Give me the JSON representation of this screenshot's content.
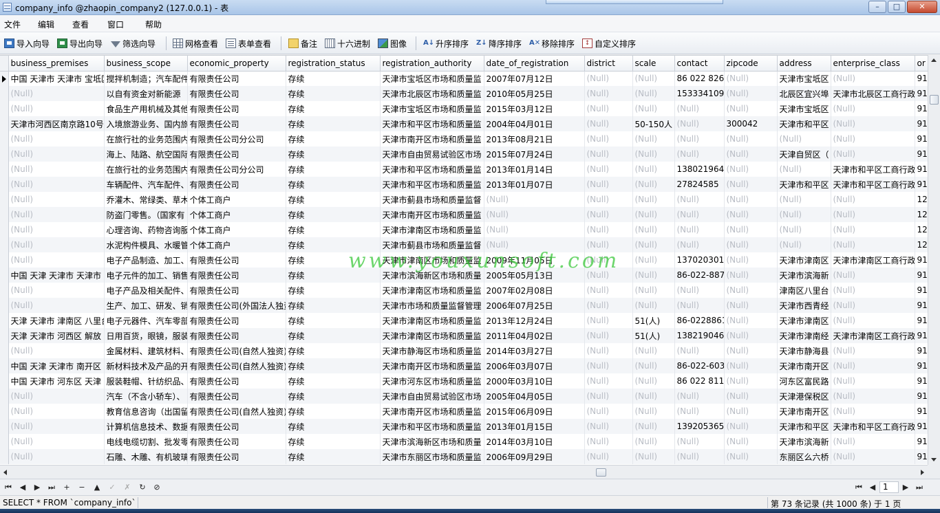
{
  "window": {
    "title": "company_info @zhaopin_company2 (127.0.0.1) - 表",
    "minimize": "–",
    "maximize": "□",
    "close": "✕"
  },
  "menu": [
    "文件",
    "编辑",
    "查看",
    "窗口",
    "帮助"
  ],
  "toolbar": {
    "import_wizard": "导入向导",
    "export_wizard": "导出向导",
    "filter_wizard": "筛选向导",
    "grid_view": "网格查看",
    "form_view": "表单查看",
    "memo": "备注",
    "hex": "十六进制",
    "image": "图像",
    "sort_asc": "升序排序",
    "sort_desc": "降序排序",
    "remove_sort": "移除排序",
    "custom_sort": "自定义排序"
  },
  "icons": {
    "import": "import-icon",
    "export": "export-icon",
    "filter": "filter-icon",
    "grid": "grid-icon",
    "form": "form-icon",
    "memo": "memo-icon",
    "hex": "hex-icon",
    "image": "image-icon",
    "sort_asc": "sort-asc-icon",
    "sort_desc": "sort-desc-icon",
    "remove_sort": "remove-sort-icon",
    "custom_sort": "custom-sort-icon"
  },
  "colors": {
    "null_text": "#b8bcc4",
    "watermark": "#3cc83c",
    "title_bar": "#b9d2ee"
  },
  "grid": {
    "columns": [
      "business_premises",
      "business_scope",
      "economic_property",
      "registration_status",
      "registration_authority",
      "date_of_registration",
      "district",
      "scale",
      "contact",
      "zipcode",
      "address",
      "enterprise_class",
      "or"
    ],
    "rows": [
      [
        "中国 天津市 天津市 宝坻区",
        "搅拌机制造；汽车配件",
        "有限责任公司",
        "存续",
        "天津市宝坻区市场和质量监",
        "2007年07月12日",
        "(Null)",
        "(Null)",
        "86 022 826",
        "(Null)",
        "天津市宝坻区",
        "(Null)",
        "91"
      ],
      [
        "(Null)",
        "以自有资金对新能源",
        "有限责任公司",
        "存续",
        "天津市北辰区市场和质量监",
        "2010年05月25日",
        "(Null)",
        "(Null)",
        "1533341099",
        "(Null)",
        "北辰区宜兴埠",
        "天津市北辰区工商行政",
        "91"
      ],
      [
        "(Null)",
        "食品生产用机械及其他",
        "有限责任公司",
        "存续",
        "天津市宝坻区市场和质量监",
        "2015年03月12日",
        "(Null)",
        "(Null)",
        "(Null)",
        "(Null)",
        "天津市宝坻区",
        "(Null)",
        "91"
      ],
      [
        "天津市河西区南京路10号",
        "入境旅游业务、国内旅",
        "有限责任公司",
        "存续",
        "天津市和平区市场和质量监",
        "2004年04月01日",
        "(Null)",
        "50-150人",
        "(Null)",
        "300042",
        "天津市和平区",
        "(Null)",
        "91"
      ],
      [
        "(Null)",
        "在旅行社的业务范围内",
        "有限责任公司分公司",
        "存续",
        "天津市南开区市场和质量监",
        "2013年08月21日",
        "(Null)",
        "(Null)",
        "(Null)",
        "(Null)",
        "(Null)",
        "(Null)",
        "91"
      ],
      [
        "(Null)",
        "海上、陆路、航空国际",
        "有限责任公司",
        "存续",
        "天津市自由贸易试验区市场",
        "2015年07月24日",
        "(Null)",
        "(Null)",
        "(Null)",
        "(Null)",
        "天津自贸区（",
        "(Null)",
        "91"
      ],
      [
        "(Null)",
        "在旅行社的业务范围内",
        "有限责任公司分公司",
        "存续",
        "天津市和平区市场和质量监",
        "2013年01月14日",
        "(Null)",
        "(Null)",
        "1380219645",
        "(Null)",
        "(Null)",
        "天津市和平区工商行政",
        "91"
      ],
      [
        "(Null)",
        "车辆配件、汽车配件、",
        "有限责任公司",
        "存续",
        "天津市和平区市场和质量监",
        "2013年01月07日",
        "(Null)",
        "(Null)",
        "27824585",
        "(Null)",
        "天津市和平区",
        "天津市和平区工商行政",
        "91"
      ],
      [
        "(Null)",
        "乔灌木、常绿类、草木",
        "个体工商户",
        "存续",
        "天津市蓟县市场和质量监督",
        "(Null)",
        "(Null)",
        "(Null)",
        "(Null)",
        "(Null)",
        "(Null)",
        "(Null)",
        "12"
      ],
      [
        "(Null)",
        "防盗门零售。（国家有",
        "个体工商户",
        "存续",
        "天津市南开区市场和质量监",
        "(Null)",
        "(Null)",
        "(Null)",
        "(Null)",
        "(Null)",
        "(Null)",
        "(Null)",
        "12"
      ],
      [
        "(Null)",
        "心理咨询、药物咨询服",
        "个体工商户",
        "存续",
        "天津市津南区市场和质量监",
        "(Null)",
        "(Null)",
        "(Null)",
        "(Null)",
        "(Null)",
        "(Null)",
        "(Null)",
        "12"
      ],
      [
        "(Null)",
        "水泥构件模具、水暖管",
        "个体工商户",
        "存续",
        "天津市蓟县市场和质量监督",
        "(Null)",
        "(Null)",
        "(Null)",
        "(Null)",
        "(Null)",
        "(Null)",
        "(Null)",
        "12"
      ],
      [
        "(Null)",
        "电子产品制造、加工、",
        "有限责任公司",
        "存续",
        "天津市津南区市场和质量监",
        "2009年11月05日",
        "(Null)",
        "(Null)",
        "1370203013",
        "(Null)",
        "天津市津南区",
        "天津市津南区工商行政",
        "91"
      ],
      [
        "中国 天津 天津市 天津市",
        "电子元件的加工、销售",
        "有限责任公司",
        "存续",
        "天津市滨海新区市场和质量",
        "2005年05月13日",
        "(Null)",
        "(Null)",
        "86-022-887",
        "(Null)",
        "天津市滨海新",
        "(Null)",
        "91"
      ],
      [
        "(Null)",
        "电子产品及相关配件、",
        "有限责任公司",
        "存续",
        "天津市津南区市场和质量监",
        "2007年02月08日",
        "(Null)",
        "(Null)",
        "(Null)",
        "(Null)",
        "津南区八里台",
        "(Null)",
        "91"
      ],
      [
        "(Null)",
        "生产、加工、研发、销",
        "有限责任公司(外国法人独资)",
        "存续",
        "天津市市场和质量监督管理",
        "2006年07月25日",
        "(Null)",
        "(Null)",
        "(Null)",
        "(Null)",
        "天津市西青经",
        "(Null)",
        "91"
      ],
      [
        "天津 天津市 津南区 八里台",
        "电子元器件、汽车零部",
        "有限责任公司",
        "存续",
        "天津市津南区市场和质量监",
        "2013年12月24日",
        "(Null)",
        "51(人)",
        "86-0228861",
        "(Null)",
        "天津市津南区",
        "(Null)",
        "91"
      ],
      [
        "天津 天津市 河西区 解放",
        "日用百货，眼镜，服装",
        "有限责任公司",
        "存续",
        "天津市津南区市场和质量监",
        "2011年04月02日",
        "(Null)",
        "51(人)",
        "1382190462",
        "(Null)",
        "天津市津南经",
        "天津市津南区工商行政",
        "91"
      ],
      [
        "(Null)",
        "金属材料、建筑材料、",
        "有限责任公司(自然人独资)",
        "存续",
        "天津市静海区市场和质量监",
        "2014年03月27日",
        "(Null)",
        "(Null)",
        "(Null)",
        "(Null)",
        "天津市静海县",
        "(Null)",
        "91"
      ],
      [
        "中国 天津 天津市 南开区",
        "新材料技术及产品的开",
        "有限责任公司(自然人独资)",
        "存续",
        "天津市南开区市场和质量监",
        "2006年03月07日",
        "(Null)",
        "(Null)",
        "86-022-603",
        "(Null)",
        "天津市南开区",
        "(Null)",
        "91"
      ],
      [
        "中国 天津市 河东区 天津",
        "服装鞋帽、针纺织品、",
        "有限责任公司",
        "存续",
        "天津市河东区市场和质量监",
        "2000年03月10日",
        "(Null)",
        "(Null)",
        "86 022 811",
        "(Null)",
        "河东区富民路",
        "(Null)",
        "91"
      ],
      [
        "(Null)",
        "汽车（不含小轿车）、",
        "有限责任公司",
        "存续",
        "天津市自由贸易试验区市场",
        "2005年04月05日",
        "(Null)",
        "(Null)",
        "(Null)",
        "(Null)",
        "天津港保税区",
        "(Null)",
        "91"
      ],
      [
        "(Null)",
        "教育信息咨询（出国留",
        "有限责任公司(自然人独资)",
        "存续",
        "天津市南开区市场和质量监",
        "2015年06月09日",
        "(Null)",
        "(Null)",
        "(Null)",
        "(Null)",
        "天津市南开区",
        "(Null)",
        "91"
      ],
      [
        "(Null)",
        "计算机信息技术、数据",
        "有限责任公司",
        "存续",
        "天津市和平区市场和质量监",
        "2013年01月15日",
        "(Null)",
        "(Null)",
        "1392053656",
        "(Null)",
        "天津市和平区",
        "天津市和平区工商行政",
        "91"
      ],
      [
        "(Null)",
        "电线电缆切割、批发零",
        "有限责任公司",
        "存续",
        "天津市滨海新区市场和质量",
        "2014年03月10日",
        "(Null)",
        "(Null)",
        "(Null)",
        "(Null)",
        "天津市滨海新",
        "(Null)",
        "91"
      ],
      [
        "(Null)",
        "石雕、木雕、有机玻璃",
        "有限责任公司",
        "存续",
        "天津市东丽区市场和质量监",
        "2006年09月29日",
        "(Null)",
        "(Null)",
        "(Null)",
        "(Null)",
        "东丽区么六桥",
        "(Null)",
        "91"
      ]
    ]
  },
  "watermark": "www.youxunsoft.com",
  "navigator": {
    "buttons": [
      "⏮",
      "◀",
      "▶",
      "⏭",
      "+",
      "−",
      "▲",
      "✓",
      "✗",
      "↻",
      "⊘"
    ],
    "page": "1",
    "page_buttons": [
      "⏮",
      "◀",
      "▶",
      "⏭"
    ]
  },
  "status": {
    "sql": "SELECT * FROM `company_info` LIMIT 0, 1000",
    "record_info": "第 73 条记录 (共 1000 条) 于 1 页"
  }
}
